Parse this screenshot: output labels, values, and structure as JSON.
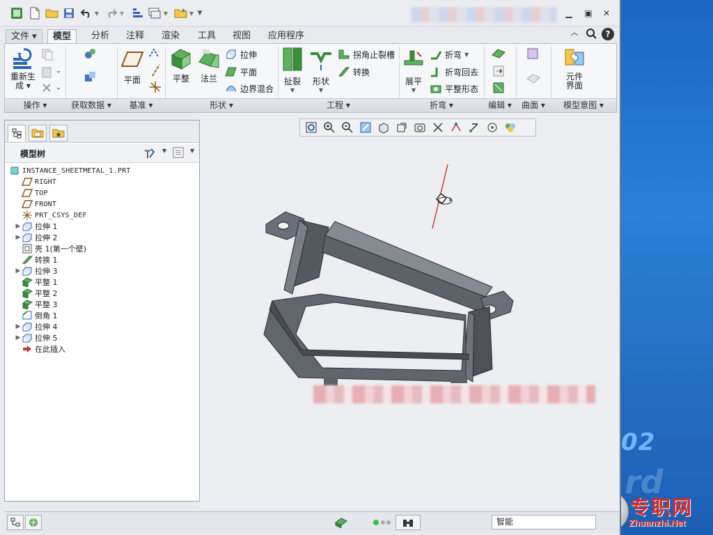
{
  "ribbon_tabs": [
    "文件",
    "模型",
    "分析",
    "注释",
    "渲染",
    "工具",
    "视图",
    "应用程序"
  ],
  "active_tab": "模型",
  "groups": {
    "operations": {
      "label": "操作",
      "regenerate": "重新生",
      "regenerate_2": "成"
    },
    "get_data": {
      "label": "获取数据"
    },
    "datum": {
      "label": "基准",
      "plane": "平面"
    },
    "shapes": {
      "label": "形状",
      "flat": "平整",
      "flange": "法兰",
      "extrude": "拉伸",
      "planar": "平面",
      "boundary_blend": "边界混合"
    },
    "engineering": {
      "label": "工程",
      "rip": "扯裂",
      "form": "形状",
      "corner_relief": "拐角止裂槽",
      "convert": "转换"
    },
    "bends": {
      "label": "折弯",
      "unbend": "展平",
      "bend": "折弯",
      "bend_back": "折弯回去",
      "flatten_form": "平整形态"
    },
    "editing": {
      "label": "编辑"
    },
    "surfaces": {
      "label": "曲面"
    },
    "model_intent": {
      "label": "模型意图",
      "component_interface": "元件",
      "component_interface_2": "界面"
    }
  },
  "model_tree": {
    "title": "模型树",
    "items": [
      {
        "label": "INSTANCE_SHEETMETAL_1.PRT",
        "icon": "part-icon",
        "expand": false,
        "mono": true
      },
      {
        "label": "RIGHT",
        "icon": "datum-plane-icon",
        "expand": false,
        "mono": true
      },
      {
        "label": "TOP",
        "icon": "datum-plane-icon",
        "expand": false,
        "mono": true
      },
      {
        "label": "FRONT",
        "icon": "datum-plane-icon",
        "expand": false,
        "mono": true
      },
      {
        "label": "PRT_CSYS_DEF",
        "icon": "csys-icon",
        "expand": false,
        "mono": true
      },
      {
        "label": "拉伸 1",
        "icon": "extrude-icon",
        "expand": true
      },
      {
        "label": "拉伸 2",
        "icon": "extrude-icon",
        "expand": true
      },
      {
        "label": "壳 1(第一个壁)",
        "icon": "shell-icon",
        "expand": false
      },
      {
        "label": "转换 1",
        "icon": "convert-icon",
        "expand": false
      },
      {
        "label": "拉伸 3",
        "icon": "extrude-icon",
        "expand": true
      },
      {
        "label": "平整 1",
        "icon": "flat-wall-icon",
        "expand": false
      },
      {
        "label": "平整 2",
        "icon": "flat-wall-icon",
        "expand": false
      },
      {
        "label": "平整 3",
        "icon": "flat-wall-icon",
        "expand": false
      },
      {
        "label": "倒角 1",
        "icon": "chamfer-icon",
        "expand": false
      },
      {
        "label": "拉伸 4",
        "icon": "extrude-icon",
        "expand": true
      },
      {
        "label": "拉伸 5",
        "icon": "extrude-icon",
        "expand": true
      },
      {
        "label": "在此插入",
        "icon": "insert-here-arrow-icon",
        "expand": false
      }
    ]
  },
  "status": {
    "filter_value": "智能"
  },
  "desktop": {
    "number_text": "02",
    "watermark_cn": "专职网",
    "watermark_en": "Zhuanzhi.Net"
  },
  "colors": {
    "accent_green": "#3a9a3a",
    "accent_blue": "#2a63b8",
    "part_gray": "#5d6168",
    "datum_red": "#d23a3a"
  }
}
